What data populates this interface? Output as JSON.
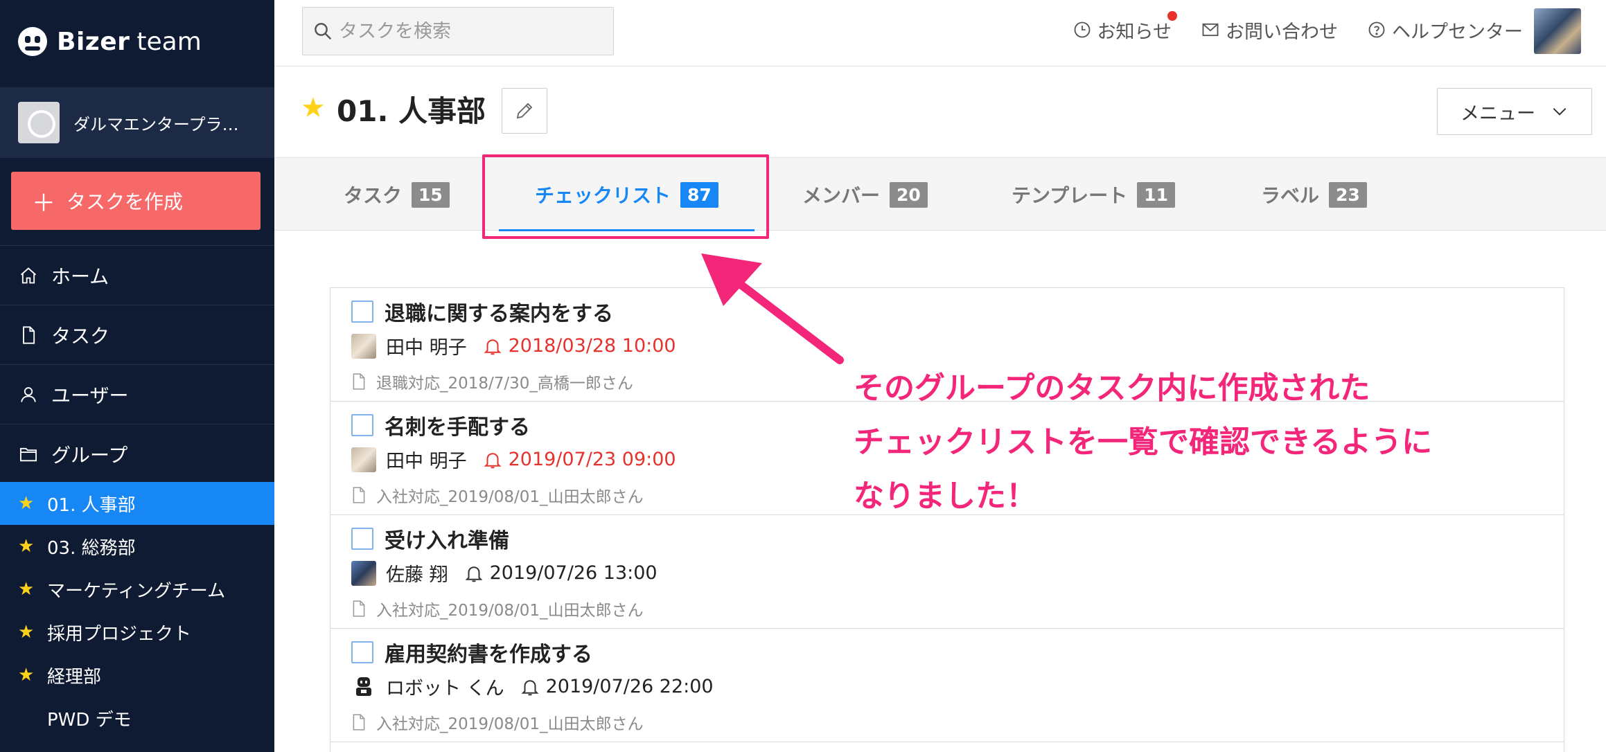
{
  "sidebar": {
    "brand": "Bizer",
    "brand_sub": "team",
    "org_name": "ダルマエンタープライズ株式会社",
    "create_button": "タスクを作成",
    "nav": [
      {
        "label": "ホーム",
        "icon": "home-icon"
      },
      {
        "label": "タスク",
        "icon": "document-icon"
      },
      {
        "label": "ユーザー",
        "icon": "user-icon"
      },
      {
        "label": "グループ",
        "icon": "folder-icon"
      }
    ],
    "groups": [
      {
        "label": "01. 人事部",
        "starred": true,
        "active": true
      },
      {
        "label": "03. 総務部",
        "starred": true,
        "active": false
      },
      {
        "label": "マーケティングチーム",
        "starred": true,
        "active": false
      },
      {
        "label": "採用プロジェクト",
        "starred": true,
        "active": false
      },
      {
        "label": "経理部",
        "starred": true,
        "active": false
      },
      {
        "label": "PWD デモ",
        "starred": false,
        "active": false
      }
    ]
  },
  "topbar": {
    "search_placeholder": "タスクを検索",
    "links": [
      {
        "label": "お知らせ",
        "icon": "clock-icon",
        "has_badge": true
      },
      {
        "label": "お問い合わせ",
        "icon": "mail-icon",
        "has_badge": false
      },
      {
        "label": "ヘルプセンター",
        "icon": "help-icon",
        "has_badge": false
      }
    ]
  },
  "header": {
    "title": "01. 人事部",
    "menu_label": "メニュー"
  },
  "tabs": [
    {
      "label": "タスク",
      "count": "15",
      "active": false
    },
    {
      "label": "チェックリスト",
      "count": "87",
      "active": true
    },
    {
      "label": "メンバー",
      "count": "20",
      "active": false
    },
    {
      "label": "テンプレート",
      "count": "11",
      "active": false
    },
    {
      "label": "ラベル",
      "count": "23",
      "active": false
    }
  ],
  "checklist": [
    {
      "title": "退職に関する案内をする",
      "assignee": "田中 明子",
      "due": "2018/03/28 10:00",
      "overdue": true,
      "task": "退職対応_2018/7/30_高橋一郎さん",
      "avatar": "tanaka"
    },
    {
      "title": "名刺を手配する",
      "assignee": "田中 明子",
      "due": "2019/07/23 09:00",
      "overdue": true,
      "task": "入社対応_2019/08/01_山田太郎さん",
      "avatar": "tanaka"
    },
    {
      "title": "受け入れ準備",
      "assignee": "佐藤 翔",
      "due": "2019/07/26 13:00",
      "overdue": false,
      "task": "入社対応_2019/08/01_山田太郎さん",
      "avatar": "sato"
    },
    {
      "title": "雇用契約書を作成する",
      "assignee": "ロボット くん",
      "due": "2019/07/26 22:00",
      "overdue": false,
      "task": "入社対応_2019/08/01_山田太郎さん",
      "avatar": "robot"
    }
  ],
  "annotation": [
    "そのグループのタスク内に作成された",
    "チェックリストを一覧で確認できるように",
    "なりました！"
  ],
  "colors": {
    "sidebar_bg": "#0f1b33",
    "accent": "#1787f5",
    "create_button": "#f76868",
    "overdue": "#e5322d",
    "annotation": "#f4267a",
    "star": "#ffd21a"
  }
}
